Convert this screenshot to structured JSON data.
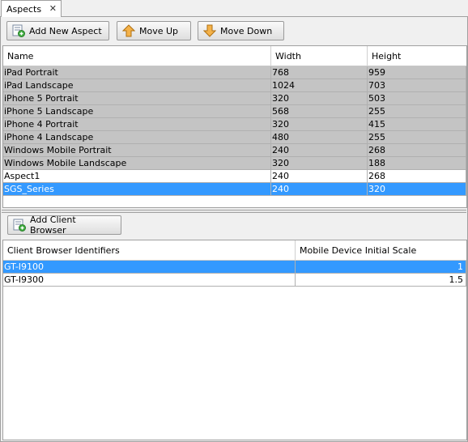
{
  "tab": {
    "title": "Aspects",
    "close": "✕"
  },
  "toolbar": {
    "add_aspect": "Add New Aspect",
    "move_up": "Move Up",
    "move_down": "Move Down"
  },
  "aspects_table": {
    "headers": [
      "Name",
      "Width",
      "Height"
    ],
    "rows": [
      {
        "name": "iPad Portrait",
        "width": "768",
        "height": "959",
        "style": "gray"
      },
      {
        "name": "iPad Landscape",
        "width": "1024",
        "height": "703",
        "style": "gray"
      },
      {
        "name": "iPhone 5 Portrait",
        "width": "320",
        "height": "503",
        "style": "gray"
      },
      {
        "name": "iPhone 5 Landscape",
        "width": "568",
        "height": "255",
        "style": "gray"
      },
      {
        "name": "iPhone 4 Portrait",
        "width": "320",
        "height": "415",
        "style": "gray"
      },
      {
        "name": "iPhone 4 Landscape",
        "width": "480",
        "height": "255",
        "style": "gray"
      },
      {
        "name": "Windows Mobile Portrait",
        "width": "240",
        "height": "268",
        "style": "gray"
      },
      {
        "name": "Windows Mobile Landscape",
        "width": "320",
        "height": "188",
        "style": "gray"
      },
      {
        "name": "Aspect1",
        "width": "240",
        "height": "268",
        "style": "white"
      },
      {
        "name": "SGS_Series",
        "width": "240",
        "height": "320",
        "style": "sel"
      }
    ]
  },
  "browser_toolbar": {
    "add_client_browser": "Add Client Browser"
  },
  "browser_table": {
    "headers": [
      "Client Browser Identifiers",
      "Mobile Device Initial Scale"
    ],
    "rows": [
      {
        "id": "GT-I9100",
        "scale": "1",
        "style": "sel"
      },
      {
        "id": "GT-I9300",
        "scale": "1.5",
        "style": "white"
      }
    ]
  },
  "colors": {
    "selection": "#3399ff",
    "gray_row": "#c4c4c4"
  },
  "icons": [
    "add-aspect-icon",
    "arrow-up-icon",
    "arrow-down-icon",
    "add-browser-icon"
  ]
}
